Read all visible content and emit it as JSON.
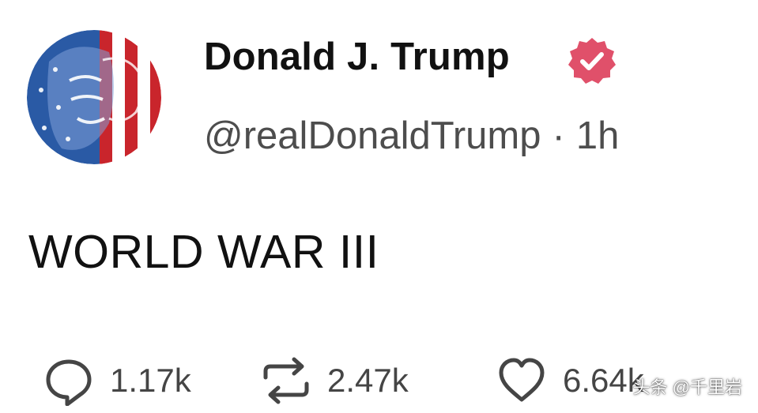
{
  "profile": {
    "display_name": "Donald J. Trump",
    "handle": "@realDonaldTrump",
    "separator": "·",
    "time_ago": "1h",
    "avatar_icon": "flag-portrait-avatar",
    "verified_icon": "verified-badge-icon"
  },
  "post": {
    "text": "WORLD WAR III"
  },
  "actions": {
    "reply": {
      "icon": "reply-icon",
      "count": "1.17k"
    },
    "repost": {
      "icon": "repost-icon",
      "count": "2.47k"
    },
    "like": {
      "icon": "heart-icon",
      "count": "6.64k"
    }
  },
  "watermark": {
    "text": "头条 @千里岩"
  },
  "colors": {
    "text": "#111111",
    "secondary": "#4d4d4d",
    "count": "#454545",
    "badge": "#e0506a",
    "flag_red": "#c9252c",
    "flag_blue": "#2a5aa5"
  }
}
